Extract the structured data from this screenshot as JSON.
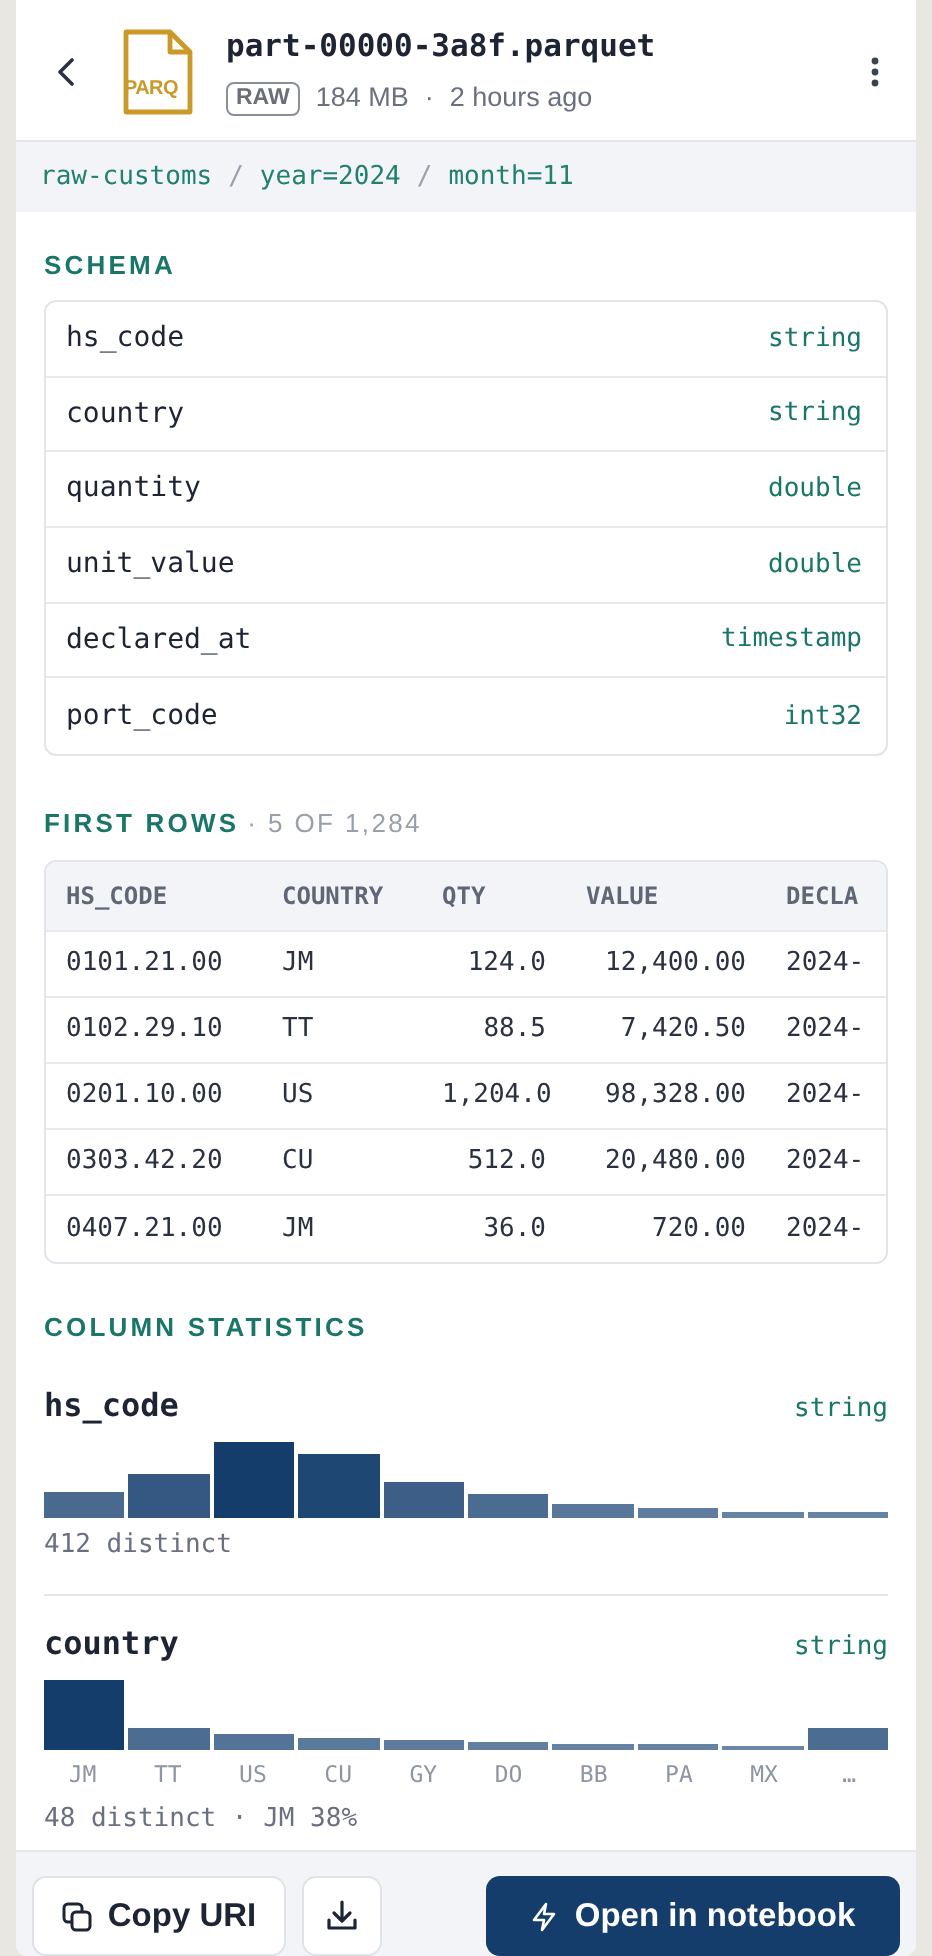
{
  "header": {
    "file_type_label": "PARQ",
    "file_name": "part-00000-3a8f.parquet",
    "badge": "RAW",
    "size": "184 MB",
    "separator": "·",
    "age": "2 hours ago"
  },
  "breadcrumb": [
    {
      "kind": "segment",
      "text": "raw-customs"
    },
    {
      "kind": "separator",
      "text": "/"
    },
    {
      "kind": "segment",
      "text": "year=2024"
    },
    {
      "kind": "separator",
      "text": "/"
    },
    {
      "kind": "segment",
      "text": "month=11"
    }
  ],
  "schema": {
    "title": "SCHEMA",
    "fields": [
      {
        "name": "hs_code",
        "type": "string"
      },
      {
        "name": "country",
        "type": "string"
      },
      {
        "name": "quantity",
        "type": "double"
      },
      {
        "name": "unit_value",
        "type": "double"
      },
      {
        "name": "declared_at",
        "type": "timestamp"
      },
      {
        "name": "port_code",
        "type": "int32"
      }
    ]
  },
  "first_rows": {
    "title": "FIRST ROWS",
    "subtitle": "· 5 OF 1,284",
    "columns": [
      {
        "label": "HS_CODE",
        "kind": "text"
      },
      {
        "label": "COUNTRY",
        "kind": "text"
      },
      {
        "label": "QTY",
        "kind": "number"
      },
      {
        "label": "VALUE",
        "kind": "number"
      },
      {
        "label": "DECLA",
        "kind": "text"
      }
    ],
    "rows": [
      [
        "0101.21.00",
        "JM",
        "124.0",
        "12,400.00",
        "2024-"
      ],
      [
        "0102.29.10",
        "TT",
        "88.5",
        "7,420.50",
        "2024-"
      ],
      [
        "0201.10.00",
        "US",
        "1,204.0",
        "98,328.00",
        "2024-"
      ],
      [
        "0303.42.20",
        "CU",
        "512.0",
        "20,480.00",
        "2024-"
      ],
      [
        "0407.21.00",
        "JM",
        "36.0",
        "720.00",
        "2024-"
      ]
    ]
  },
  "column_statistics": {
    "title": "COLUMN STATISTICS",
    "columns": [
      {
        "name": "hs_code",
        "type": "string",
        "summary": "412 distinct"
      },
      {
        "name": "country",
        "type": "string",
        "labels": [
          "JM",
          "TT",
          "US",
          "CU",
          "GY",
          "DO",
          "BB",
          "PA",
          "MX",
          "…"
        ],
        "summary": "48 distinct · JM 38%"
      }
    ]
  },
  "footer": {
    "copy_button": "Copy URI",
    "open_button": "Open in notebook"
  }
}
